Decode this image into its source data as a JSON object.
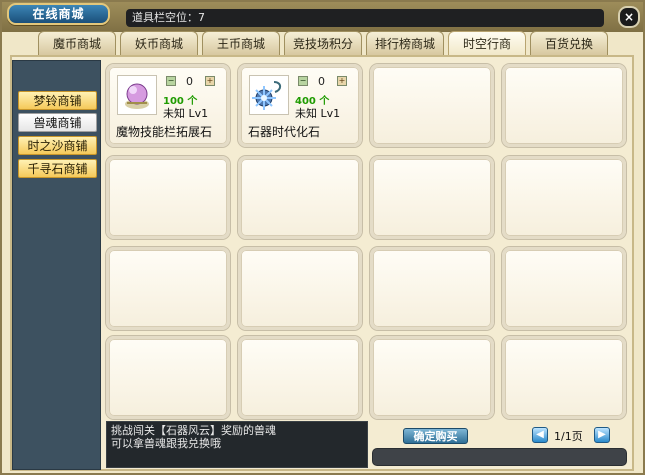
{
  "window": {
    "title": "在线商城",
    "slot_text": "道具栏空位：7",
    "close_label": "×"
  },
  "tabs": [
    {
      "label": "魔币商城"
    },
    {
      "label": "妖币商城"
    },
    {
      "label": "王币商城"
    },
    {
      "label": "竞技场积分"
    },
    {
      "label": "排行榜商城"
    },
    {
      "label": "时空行商",
      "active": true
    },
    {
      "label": "百货兑换"
    }
  ],
  "sidebar": {
    "items": [
      {
        "label": "梦铃商铺"
      },
      {
        "label": "兽魂商铺",
        "active": true
      },
      {
        "label": "时之沙商铺"
      },
      {
        "label": "千寻石商铺"
      }
    ]
  },
  "items": [
    {
      "name": "魔物技能栏拓展石",
      "count": "100 个",
      "status": "未知  Lv1",
      "qty": "0",
      "icon": "magic-orb-stone-icon"
    },
    {
      "name": "石器时代化石",
      "count": "400 个",
      "status": "未知  Lv1",
      "qty": "0",
      "icon": "spiked-flail-icon"
    }
  ],
  "controls": {
    "minus": "−",
    "plus": "+"
  },
  "footer": {
    "message_line1": "挑战闯关【石器风云】奖励的兽魂",
    "message_line2": "可以拿兽魂跟我兑换哦",
    "buy_label": "确定购买",
    "page_text": "1/1页",
    "prev_icon": "◀",
    "next_icon": "▶"
  },
  "colors": {
    "accent": "#3b86b6",
    "count_green": "#1e9b00",
    "sidebar_bg": "#3d5160"
  }
}
